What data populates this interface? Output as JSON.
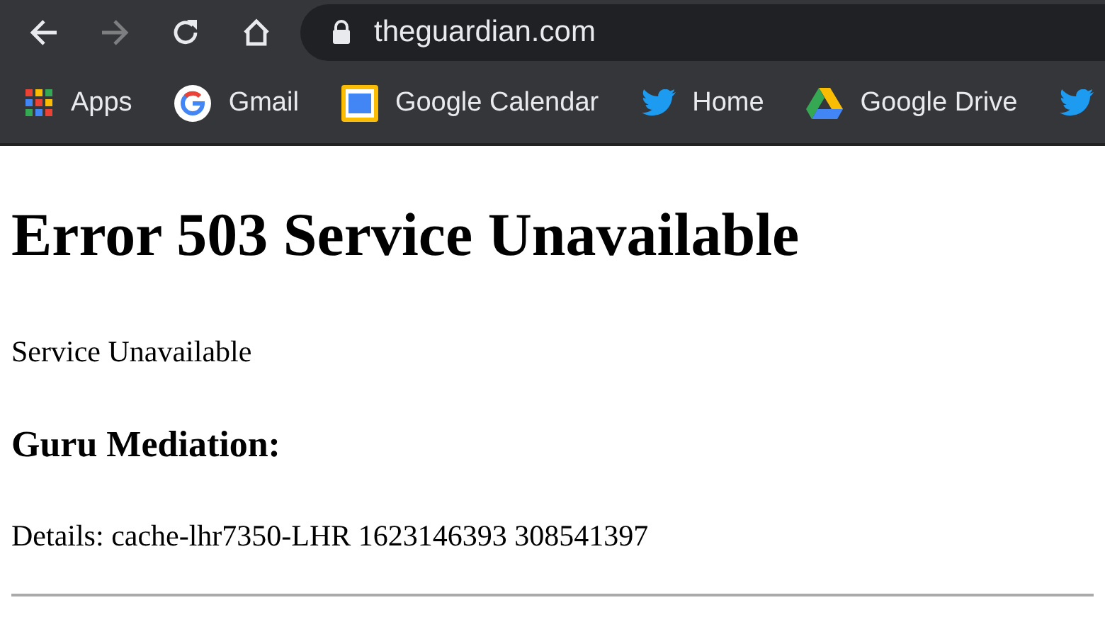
{
  "toolbar": {
    "buttons": [
      {
        "kind": "back",
        "disabled": false
      },
      {
        "kind": "forward",
        "disabled": true
      },
      {
        "kind": "reload",
        "disabled": false
      },
      {
        "kind": "home",
        "disabled": false
      }
    ],
    "url": "theguardian.com"
  },
  "bookmarks": [
    {
      "kind": "apps",
      "label": "Apps"
    },
    {
      "kind": "google",
      "label": "Gmail"
    },
    {
      "kind": "calendar",
      "label": "Google Calendar"
    },
    {
      "kind": "bird",
      "label": "Home"
    },
    {
      "kind": "drive",
      "label": "Google Drive"
    },
    {
      "kind": "bird"
    }
  ],
  "page": {
    "heading": "Error 503 Service Unavailable",
    "message": "Service Unavailable",
    "subheading": "Guru Mediation:",
    "details": "Details: cache-lhr7350-LHR 1623146393 308541397"
  }
}
